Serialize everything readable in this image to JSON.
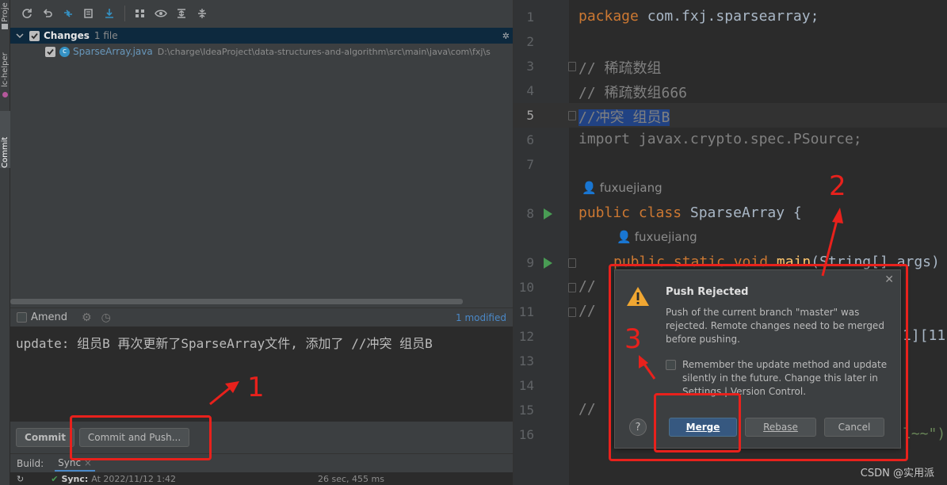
{
  "tool_strip": {
    "tabs": [
      "Proje",
      "lc-helper",
      "Commit"
    ]
  },
  "commit_panel": {
    "changes_label": "Changes",
    "changes_count": "1 file",
    "file_name": "SparseArray.java",
    "file_path": "D:\\charge\\IdeaProject\\data-structures-and-algorithm\\src\\main\\java\\com\\fxj\\s",
    "amend_label": "Amend",
    "modified_label": "1 modified",
    "commit_message": "update: 组员B 再次更新了SparseArray文件, 添加了 //冲突 组员B",
    "commit_button": "Commit",
    "commit_push_button": "Commit and Push..."
  },
  "build": {
    "label": "Build:",
    "tab": "Sync",
    "sync_label": "Sync:",
    "sync_time": "At 2022/11/12 1:42",
    "sync_duration": "26 sec, 455 ms"
  },
  "editor": {
    "line_numbers": [
      "1",
      "2",
      "3",
      "4",
      "5",
      "6",
      "7",
      "8",
      "9",
      "10",
      "11",
      "12",
      "13",
      "14",
      "15",
      "16"
    ],
    "current_line": "5",
    "line1_kw": "package",
    "line1_rest": " com.fxj.sparsearray;",
    "line3": "// 稀疏数组",
    "line4": "// 稀疏数组666",
    "line5": "//冲突 组员B",
    "line6_kw": "import",
    "line6_rest": " javax.crypto.spec.PSource;",
    "author1": "fuxuejiang",
    "line8_kw": "public class",
    "line8_rest": " SparseArray {",
    "author2": "fuxuejiang",
    "line9_kw": "public static void",
    "line9_fn": "main",
    "line9_rest": "(String[] args)",
    "line10": "//",
    "line11": "//",
    "line12_tail": "1][11]",
    "line15": "//",
    "line16_tail": "l~~\")"
  },
  "dialog": {
    "title": "Push Rejected",
    "message": "Push of the current branch \"master\" was rejected. Remote changes need to be merged before pushing.",
    "remember_text": "Remember the update method and update silently in the future. Change this later in Settings | Version Control.",
    "merge_button": "Merge",
    "rebase_button": "Rebase",
    "cancel_button": "Cancel",
    "help_glyph": "?"
  },
  "annotations": {
    "n1": "1",
    "n2": "2",
    "n3": "3"
  },
  "watermark": "CSDN @实用派",
  "colors": {
    "annotation_red": "#e8211c",
    "primary_button": "#365880",
    "run_green": "#499c54"
  }
}
